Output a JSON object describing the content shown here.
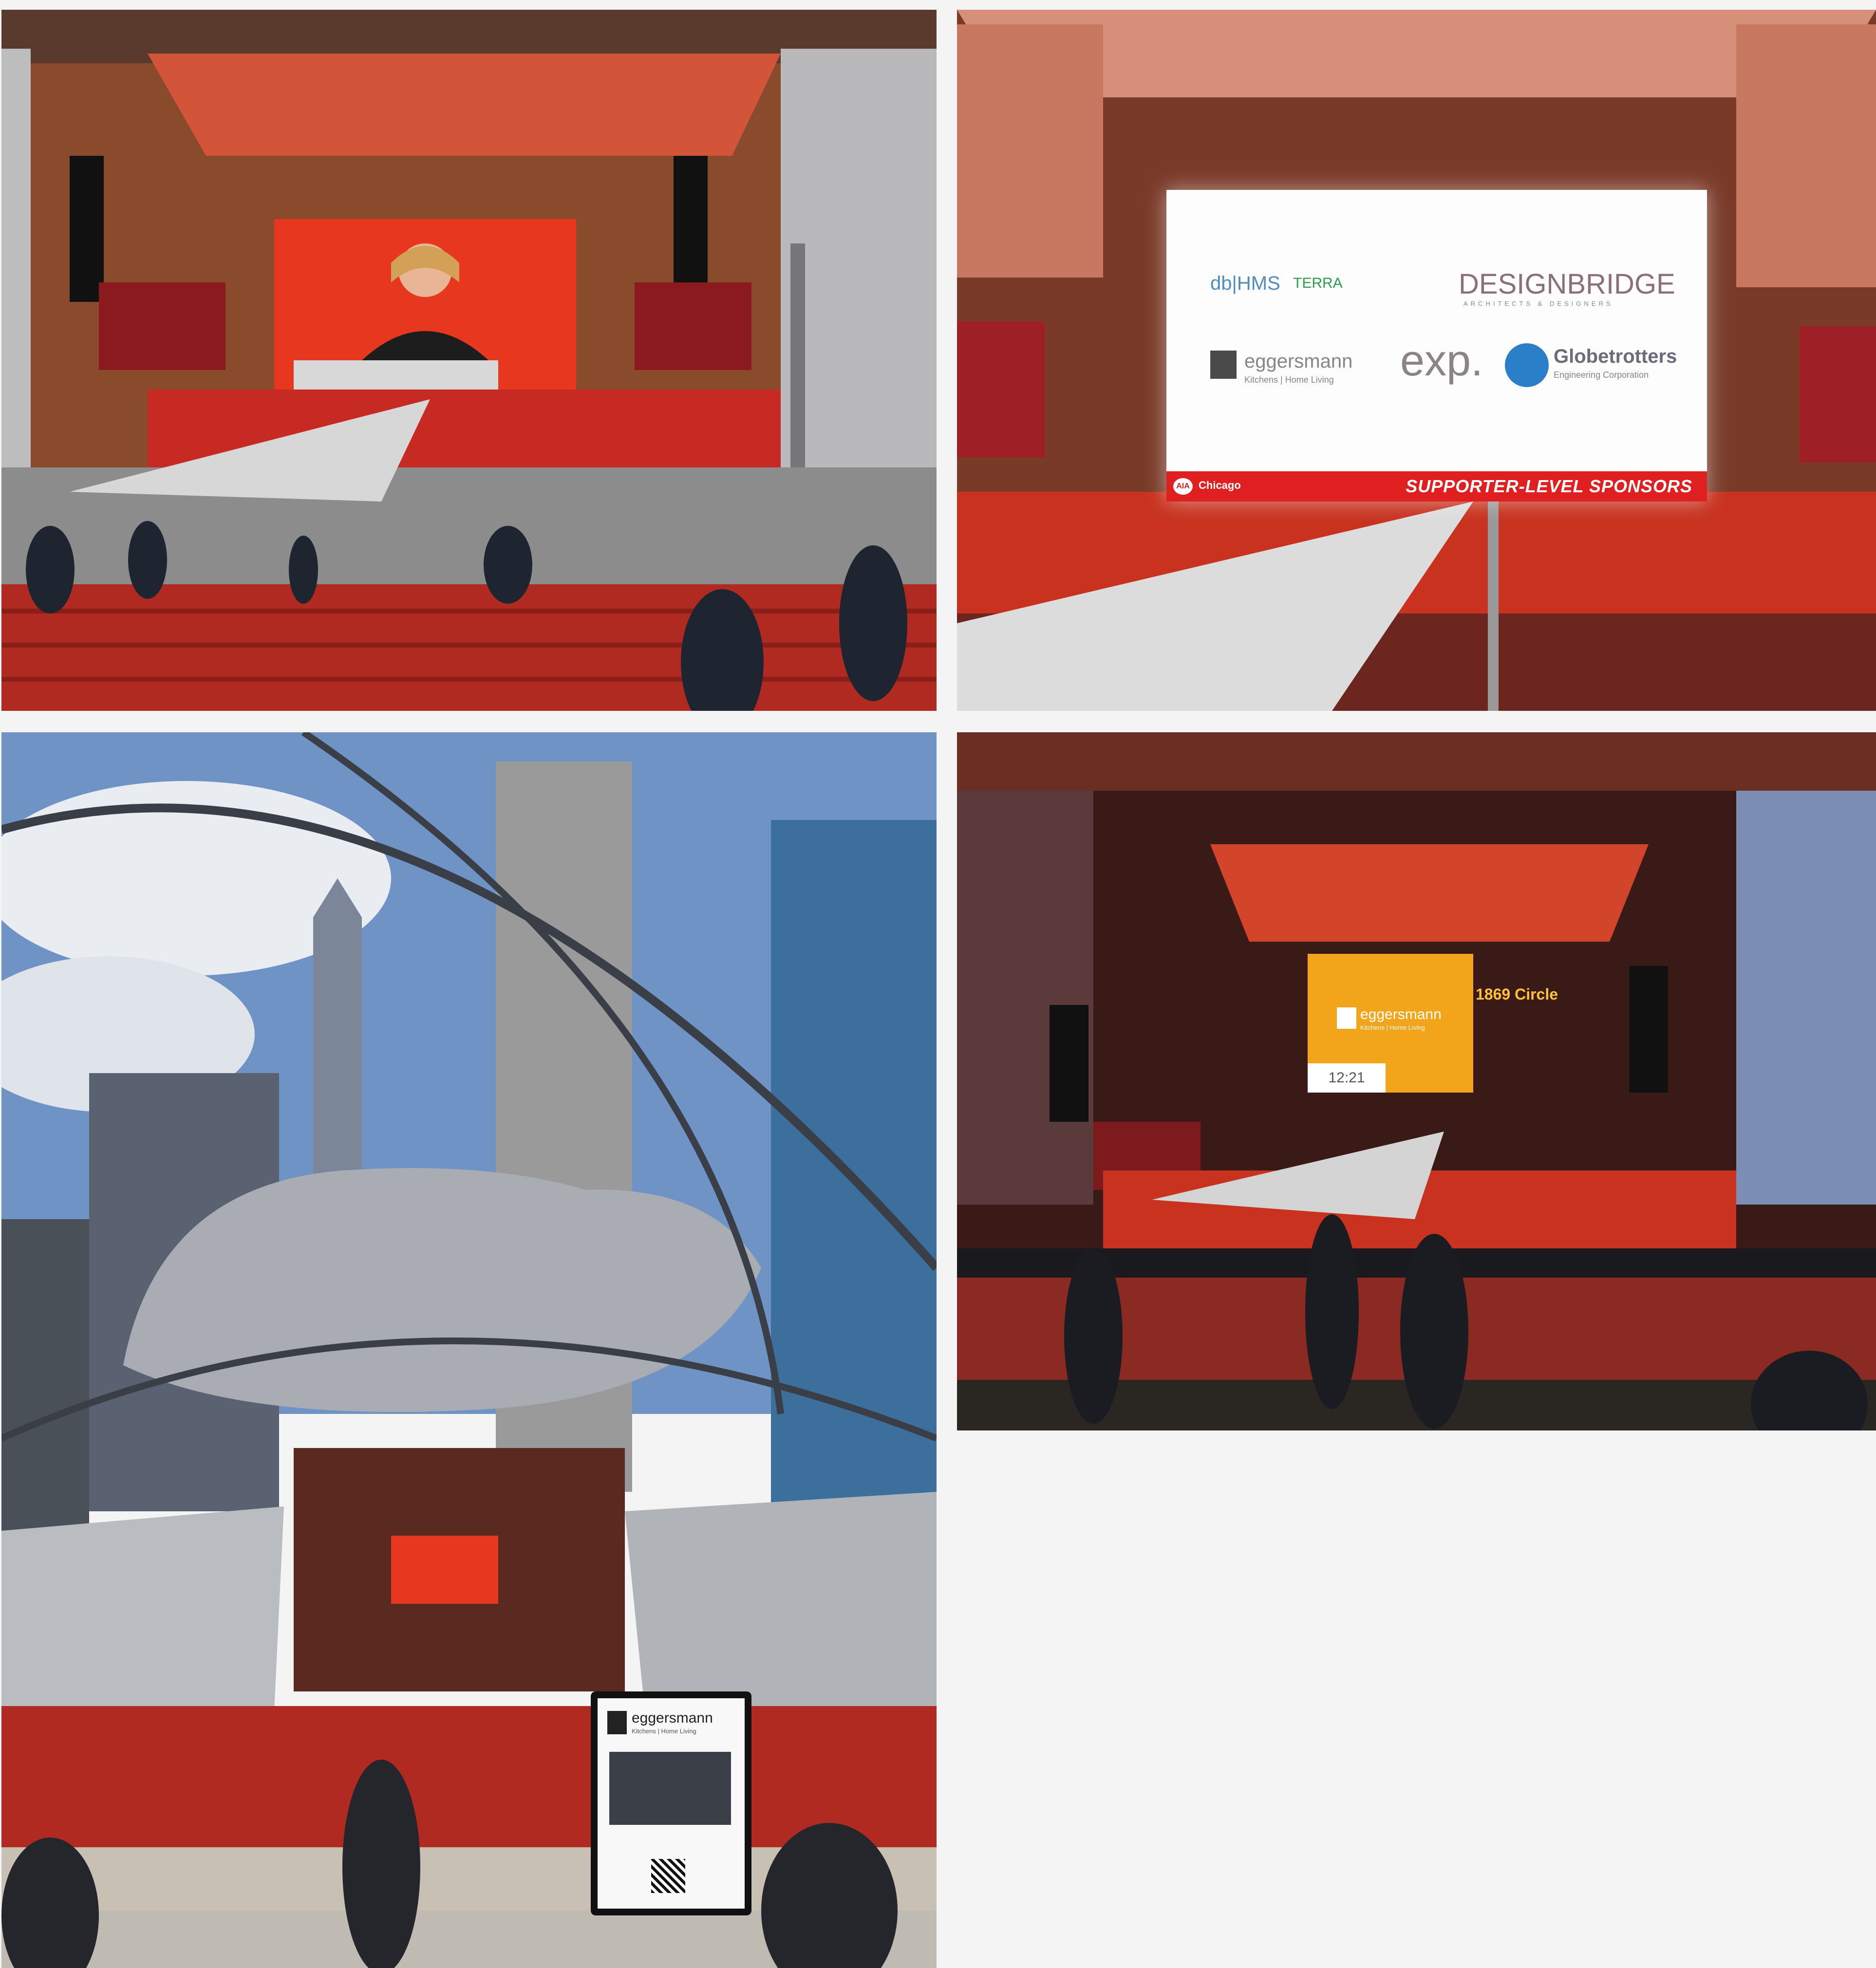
{
  "photos": [
    {
      "id": "photo-1",
      "subject": "stage-with-speaker"
    },
    {
      "id": "photo-2",
      "subject": "sponsor-screen"
    },
    {
      "id": "photo-3",
      "subject": "pavilion-exterior-skyline"
    },
    {
      "id": "photo-4",
      "subject": "stage-evening-yellow-screen"
    }
  ],
  "sponsor_screen": {
    "logos": {
      "dbhms": "db|HMS",
      "terra": "TERRA",
      "designbridge": "DESIGNBRIDGE",
      "designbridge_sub": "ARCHITECTS & DESIGNERS",
      "eggersmann": "eggersmann",
      "eggersmann_sub": "Kitchens | Home Living",
      "exp": "exp.",
      "globetrotters": "Globetrotters",
      "globetrotters_sub": "Engineering Corporation"
    },
    "org_mark": "AIA",
    "org_city": "Chicago",
    "caption": "SUPPORTER-LEVEL SPONSORS"
  },
  "sign_stand": {
    "brand": "eggersmann",
    "sub": "Kitchens | Home Living"
  },
  "evening_screen": {
    "brand": "eggersmann",
    "sub": "Kitchens | Home Living",
    "clock": "12:21",
    "side_title": "1869 Circle"
  },
  "colors": {
    "stage_red": "#c8321e",
    "seat_red": "#b02a22",
    "sky_blue": "#6f93c4",
    "steel": "#a9adb3",
    "screen_yellow": "#f2a51a"
  }
}
